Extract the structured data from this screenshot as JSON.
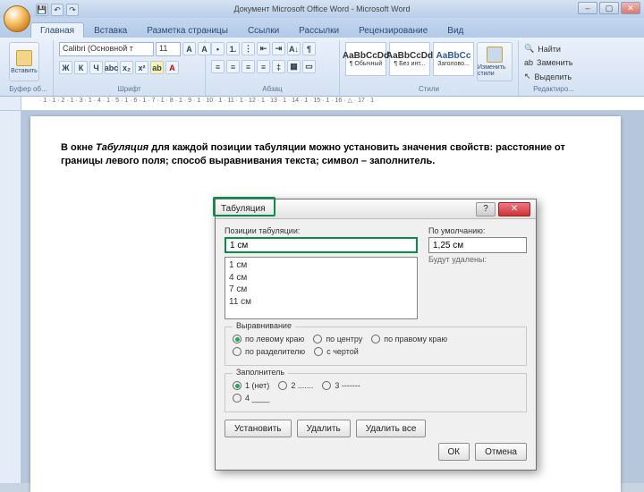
{
  "window": {
    "title": "Документ Microsoft Office Word - Microsoft Word"
  },
  "tabs": [
    "Главная",
    "Вставка",
    "Разметка страницы",
    "Ссылки",
    "Рассылки",
    "Рецензирование",
    "Вид"
  ],
  "ribbon": {
    "clipboard": {
      "label": "Буфер об...",
      "paste": "Вставить"
    },
    "font": {
      "label": "Шрифт",
      "name": "Calibri (Основной т",
      "size": "11"
    },
    "paragraph": {
      "label": "Абзац"
    },
    "styles": {
      "label": "Стили",
      "items": [
        {
          "sample": "AaBbCcDd",
          "name": "¶ Обычный"
        },
        {
          "sample": "AaBbCcDd",
          "name": "¶ Без инт..."
        },
        {
          "sample": "AaBbCc",
          "name": "Заголово..."
        }
      ],
      "change": "Изменить стили"
    },
    "editing": {
      "label": "Редактиро...",
      "find": "Найти",
      "replace": "Заменить",
      "select": "Выделить"
    }
  },
  "ruler_text": "· 1 · 1 · 2 · 1 · 3 · 1 · 4 · 1 · 5 · 1 · 6 · 1 · 7 · 1 · 8 · 1 · 9 · 1 · 10 · 1 · 11 · 1 · 12 · 1 · 13 · 1 · 14 · 1 · 15 · 1 · 16 · △ · 17 · 1",
  "doc": {
    "p1a": "В окне ",
    "p1em": "Табуляция",
    "p1b": " для каждой позиции табуляции можно установить значения свойств: расстояние от границы левого поля; способ выравнивания текста; символ – заполнитель."
  },
  "dialog": {
    "title": "Табуляция",
    "positions_label": "Позиции табуляции:",
    "default_label": "По умолчанию:",
    "default_value": "1,25 см",
    "current": "1 см",
    "list": [
      "1 см",
      "4 см",
      "7 см",
      "11 см"
    ],
    "remove_note": "Будут удалены:",
    "align_legend": "Выравнивание",
    "align": {
      "left": "по левому краю",
      "center": "по центру",
      "right": "по правому краю",
      "decimal": "по разделителю",
      "bar": "с чертой"
    },
    "fill_legend": "Заполнитель",
    "fill": {
      "none": "1 (нет)",
      "dots": "2 .......",
      "dashes": "3 -------",
      "under": "4 ____"
    },
    "set": "Установить",
    "clear": "Удалить",
    "clear_all": "Удалить все",
    "ok": "ОК",
    "cancel": "Отмена"
  }
}
